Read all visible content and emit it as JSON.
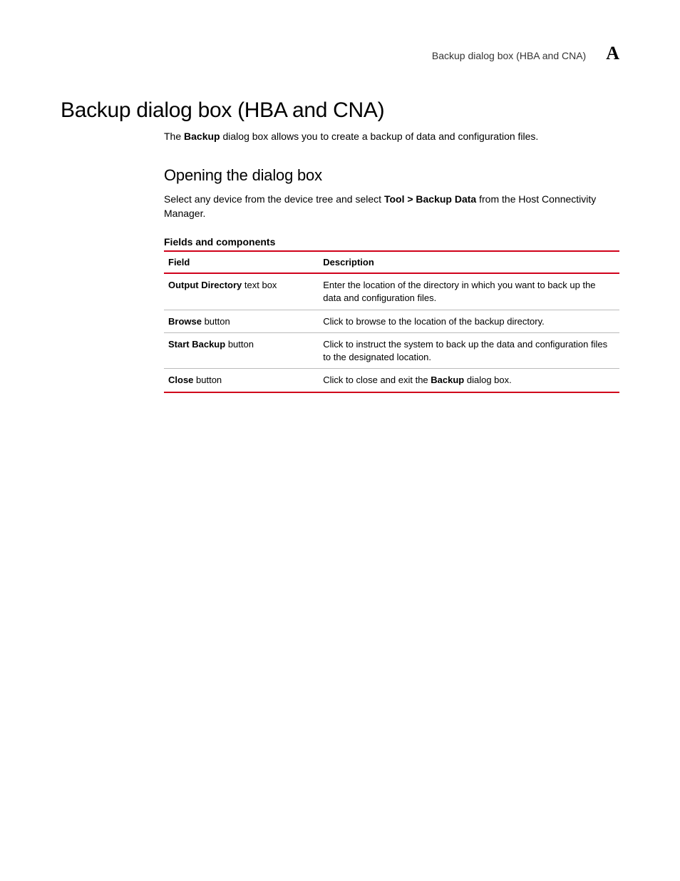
{
  "header": {
    "running_title": "Backup dialog box (HBA and CNA)",
    "appendix_letter": "A"
  },
  "title": "Backup dialog box (HBA and CNA)",
  "intro": {
    "pre": "The ",
    "bold": "Backup",
    "post": " dialog box allows you to create a backup of data and configuration files."
  },
  "section": {
    "heading": "Opening the dialog box",
    "para": {
      "pre": "Select any device from the device tree and select ",
      "bold": "Tool > Backup Data",
      "post": " from the Host Connectivity Manager."
    }
  },
  "table": {
    "caption": "Fields and components",
    "col_field": "Field",
    "col_desc": "Description",
    "rows": [
      {
        "field_bold": "Output Directory",
        "field_rest": " text box",
        "desc_pre": "Enter the location of the directory in which you want to back up the data and configuration files.",
        "desc_bold": "",
        "desc_post": ""
      },
      {
        "field_bold": "Browse",
        "field_rest": " button",
        "desc_pre": "Click to browse to the location of the backup directory.",
        "desc_bold": "",
        "desc_post": ""
      },
      {
        "field_bold": "Start Backup",
        "field_rest": " button",
        "desc_pre": "Click to instruct the system to back up the data and configuration files to the designated location.",
        "desc_bold": "",
        "desc_post": ""
      },
      {
        "field_bold": "Close",
        "field_rest": " button",
        "desc_pre": "Click to close and exit the ",
        "desc_bold": "Backup",
        "desc_post": " dialog box."
      }
    ]
  }
}
